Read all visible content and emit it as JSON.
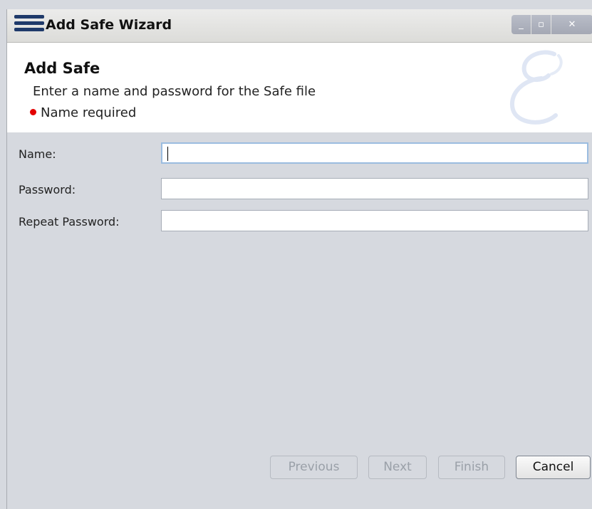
{
  "window": {
    "title": "Add Safe Wizard"
  },
  "header": {
    "title": "Add Safe",
    "description": "Enter a name and password for the Safe file",
    "error": "Name required",
    "error_color": "#e30000"
  },
  "form": {
    "name": {
      "label": "Name:",
      "value": ""
    },
    "password": {
      "label": "Password:",
      "value": ""
    },
    "repeat_password": {
      "label": "Repeat Password:",
      "value": ""
    }
  },
  "buttons": {
    "previous": "Previous",
    "next": "Next",
    "finish": "Finish",
    "cancel": "Cancel"
  },
  "icons": [
    "app-logo-icon",
    "minimize-icon",
    "maximize-icon",
    "close-icon",
    "error-dot-icon",
    "wizard-watermark-icon"
  ]
}
